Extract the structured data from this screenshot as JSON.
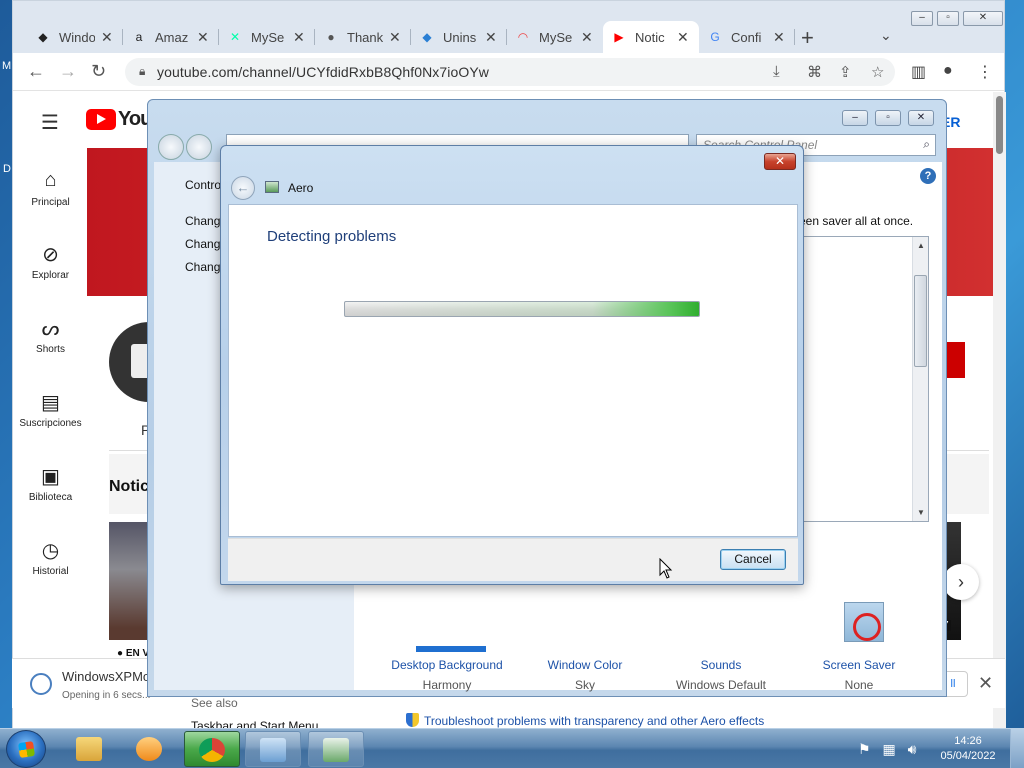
{
  "browser": {
    "tabs": [
      {
        "title": "Windo",
        "icon": "github-icon",
        "icon_glyph": "◆",
        "icon_color": "#222"
      },
      {
        "title": "Amaz",
        "icon": "amazon-icon",
        "icon_glyph": "a",
        "icon_color": "#222"
      },
      {
        "title": "MySe",
        "icon": "myservers-icon",
        "icon_glyph": "✕",
        "icon_color": "#0fa"
      },
      {
        "title": "Thank",
        "icon": "globe-icon",
        "icon_glyph": "●",
        "icon_color": "#555"
      },
      {
        "title": "Unins",
        "icon": "uninstall-icon",
        "icon_glyph": "◆",
        "icon_color": "#2a7fd4"
      },
      {
        "title": "MySe",
        "icon": "rainbow-icon",
        "icon_glyph": "◠",
        "icon_color": "#e44"
      },
      {
        "title": "Notic",
        "icon": "youtube-icon",
        "icon_glyph": "▶",
        "icon_color": "#f00"
      },
      {
        "title": "Confi",
        "icon": "google-icon",
        "icon_glyph": "G",
        "icon_color": "#4285f4"
      }
    ],
    "address": "youtube.com/channel/UCYfdidRxbB8Qhf0Nx7ioOYw",
    "download_bar": {
      "filename": "WindowsXPMo",
      "status": "Opening in 6 secs..."
    }
  },
  "youtube": {
    "logo_text": "YouTube",
    "subscribe_partial": "ER",
    "sidebar": [
      {
        "label": "Principal",
        "icon": "home-icon",
        "glyph": "⌂"
      },
      {
        "label": "Explorar",
        "icon": "compass-icon",
        "glyph": "⊘"
      },
      {
        "label": "Shorts",
        "icon": "shorts-icon",
        "glyph": "ᔕ"
      },
      {
        "label": "Suscripciones",
        "icon": "subscriptions-icon",
        "glyph": "▤"
      },
      {
        "label": "Biblioteca",
        "icon": "library-icon",
        "glyph": "▣"
      },
      {
        "label": "Historial",
        "icon": "history-icon",
        "glyph": "◷"
      }
    ],
    "section_title": "Notic",
    "tab_partial": "P",
    "live_label": "EN V",
    "duration_partial": "7"
  },
  "control_panel": {
    "search_placeholder": "Search Control Panel",
    "left_links": [
      "Contro",
      "Chang",
      "Chang",
      "Chang"
    ],
    "description": "een saver all at once.",
    "properties": [
      {
        "name": "Desktop Background",
        "value": "Harmony"
      },
      {
        "name": "Window Color",
        "value": "Sky"
      },
      {
        "name": "Sounds",
        "value": "Windows Default"
      },
      {
        "name": "Screen Saver",
        "value": "None"
      }
    ],
    "see_also": "See also",
    "see_also_link": "Taskbar and Start Menu",
    "troubleshoot_link": "Troubleshoot problems with transparency and other Aero effects"
  },
  "dialog": {
    "title": "Aero",
    "heading": "Detecting problems",
    "cancel": "Cancel",
    "progress": 1.0
  },
  "taskbar": {
    "time": "14:26",
    "date": "05/04/2022"
  },
  "desktop": {
    "left_letters": [
      "M",
      "D"
    ]
  }
}
